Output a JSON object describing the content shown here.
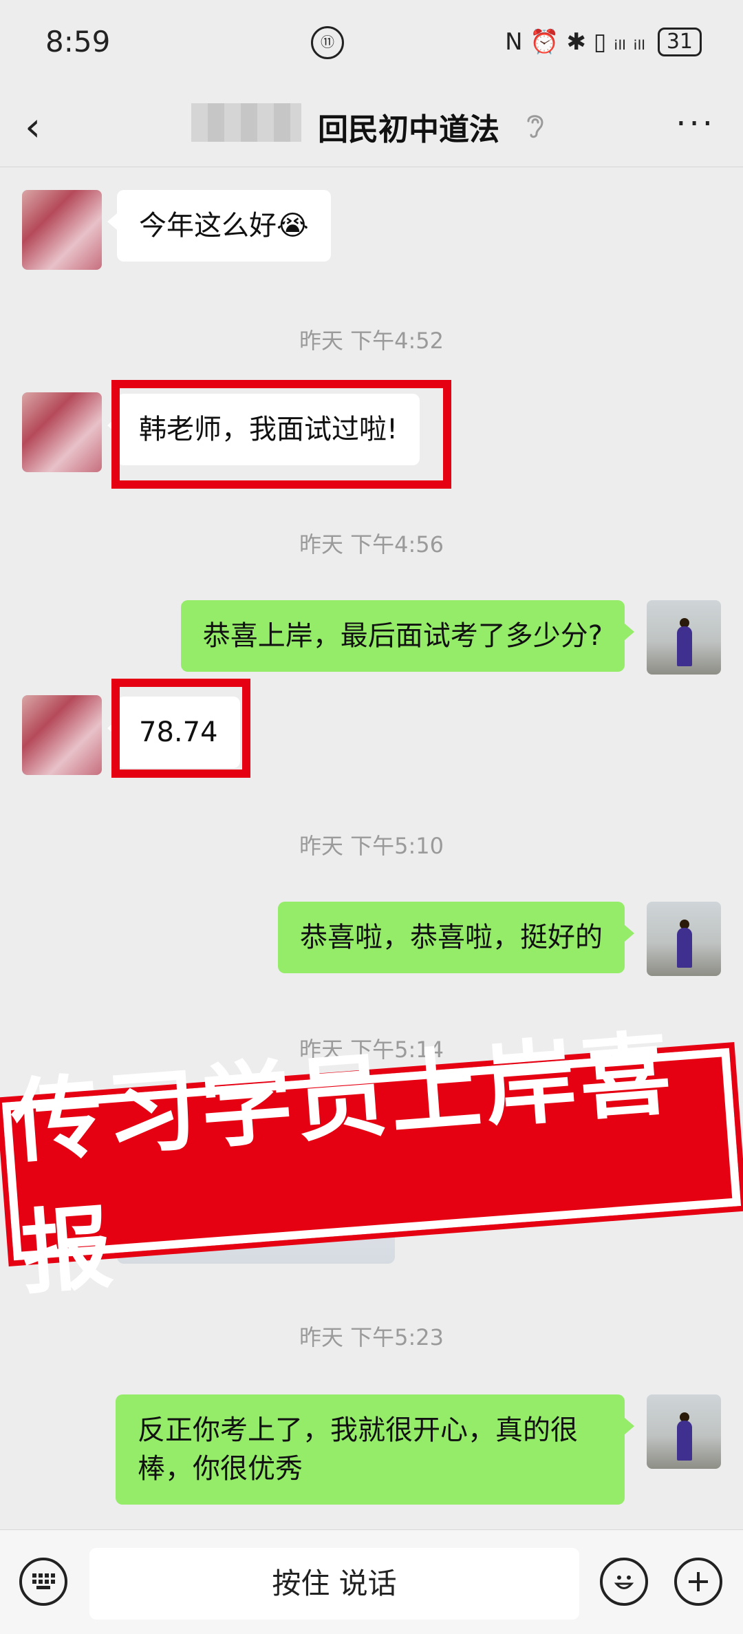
{
  "status_bar": {
    "time": "8:59",
    "center_icon": "⑪",
    "right_icons": "N ⏰ ✱ ▯ ᵢₗₗ ᵢₗₗ",
    "battery": "31"
  },
  "header": {
    "back_icon": "‹",
    "title": "回民初中道法",
    "ear_icon": "ear-icon",
    "more_icon": "···"
  },
  "messages": [
    {
      "side": "left",
      "text": "今年这么好😭"
    },
    {
      "timestamp": "昨天 下午4:52"
    },
    {
      "side": "left",
      "text": "韩老师，我面试过啦!"
    },
    {
      "timestamp": "昨天 下午4:56"
    },
    {
      "side": "right",
      "text": "恭喜上岸，最后面试考了多少分?"
    },
    {
      "side": "left",
      "text": "78.74"
    },
    {
      "timestamp": "昨天 下午5:10"
    },
    {
      "side": "right",
      "text": "恭喜啦，恭喜啦，挺好的"
    },
    {
      "timestamp": "昨天 下午5:14"
    },
    {
      "timestamp": "昨天 下午5:23"
    },
    {
      "side": "right",
      "text": "反正你考上了，我就很开心，真的很棒，你很优秀"
    }
  ],
  "overlay_banner": "传习学员上岸喜报",
  "input_bar": {
    "hold_to_talk": "按住 说话",
    "keyboard_icon": "keyboard-icon",
    "emoji_icon": "emoji-icon",
    "plus_icon": "plus-icon"
  },
  "colors": {
    "background": "#ededed",
    "green_bubble": "#95ec69",
    "highlight_red": "#e50012"
  }
}
